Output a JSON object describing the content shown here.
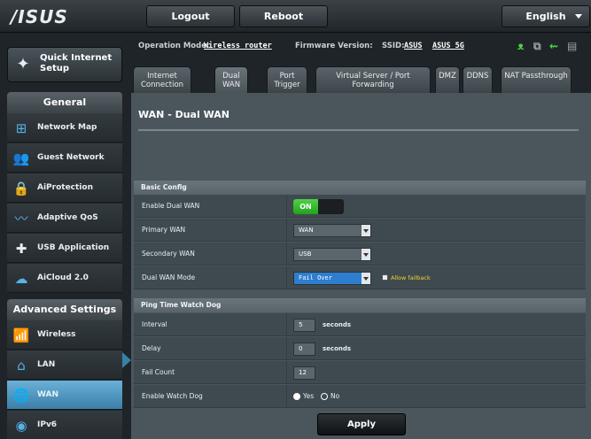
{
  "header": {
    "logo": "/ISUS",
    "logout": "Logout",
    "reboot": "Reboot",
    "language": "English"
  },
  "info": {
    "op_mode_label": "Operation Mode:",
    "op_mode_value": "Wireless router",
    "fw_label": "Firmware Version:",
    "ssid_label": "SSID:",
    "ssid_1": "ASUS",
    "ssid_2": "ASUS_5G"
  },
  "sidebar": {
    "qis_label": "Quick Internet Setup",
    "general_heading": "General",
    "general_items": [
      {
        "label": "Network Map",
        "icon": "network-map-icon"
      },
      {
        "label": "Guest Network",
        "icon": "guest-network-icon"
      },
      {
        "label": "AiProtection",
        "icon": "lock-icon"
      },
      {
        "label": "Adaptive QoS",
        "icon": "qos-icon"
      },
      {
        "label": "USB Application",
        "icon": "puzzle-icon"
      },
      {
        "label": "AiCloud 2.0",
        "icon": "cloud-icon"
      }
    ],
    "advanced_heading": "Advanced Settings",
    "advanced_items": [
      {
        "label": "Wireless",
        "icon": "wifi-icon"
      },
      {
        "label": "LAN",
        "icon": "home-icon"
      },
      {
        "label": "WAN",
        "icon": "globe-icon",
        "active": true
      },
      {
        "label": "IPv6",
        "icon": "ipv6-icon"
      }
    ]
  },
  "tabs": [
    {
      "label": "Internet Connection"
    },
    {
      "label": "Dual WAN",
      "active": true
    },
    {
      "label": "Port Trigger"
    },
    {
      "label": "Virtual Server / Port Forwarding"
    },
    {
      "label": "DMZ"
    },
    {
      "label": "DDNS"
    },
    {
      "label": "NAT Passthrough"
    }
  ],
  "page": {
    "title": "WAN - Dual WAN",
    "basic": {
      "heading": "Basic Config",
      "enable_label": "Enable Dual WAN",
      "enable_value": "ON",
      "primary_label": "Primary WAN",
      "primary_value": "WAN",
      "secondary_label": "Secondary WAN",
      "secondary_value": "USB",
      "mode_label": "Dual WAN Mode",
      "mode_value": "Fail Over",
      "allow_fallback": "Allow failback"
    },
    "watchdog": {
      "heading": "Ping Time Watch Dog",
      "interval_label": "Interval",
      "interval_value": "5",
      "interval_unit": "seconds",
      "delay_label": "Delay",
      "delay_value": "0",
      "delay_unit": "seconds",
      "failcount_label": "Fail Count",
      "failcount_value": "12",
      "enable_label": "Enable Watch Dog",
      "yes": "Yes",
      "no": "No"
    },
    "apply": "Apply"
  },
  "colors": {
    "accent": "#3b7fa8",
    "toggle_on": "#2fb82a",
    "highlight": "#2e7ed0",
    "fallback_text": "#f2d22c"
  }
}
